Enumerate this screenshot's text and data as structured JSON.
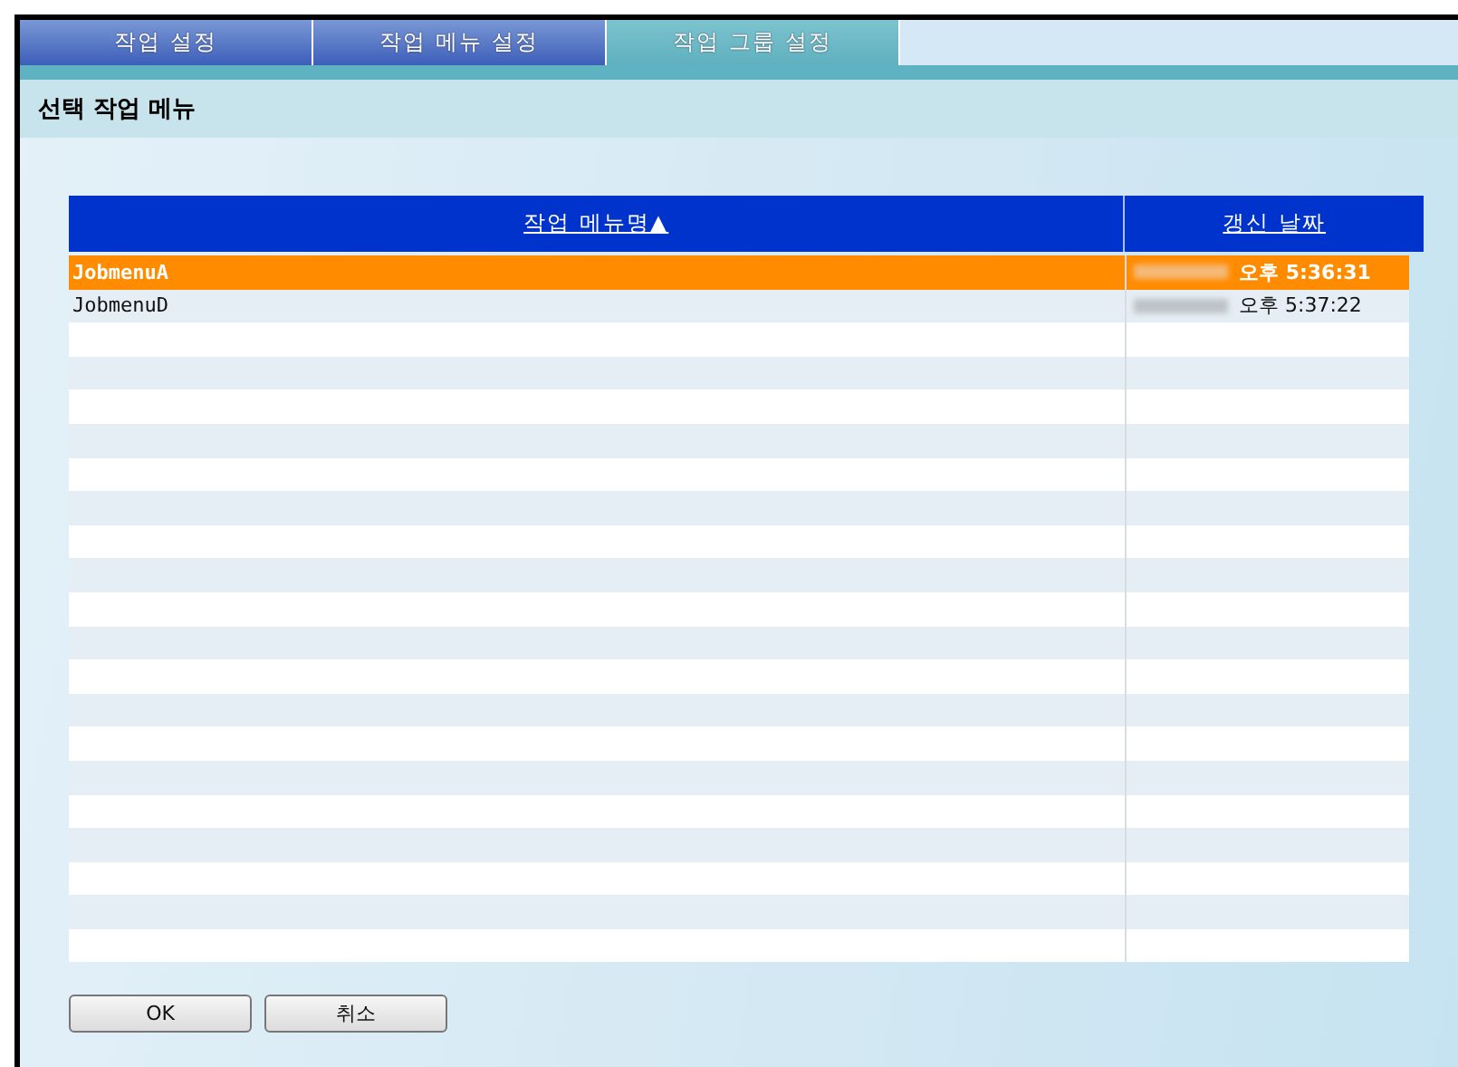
{
  "tabs": [
    {
      "label": "작업 설정",
      "selected": false
    },
    {
      "label": "작업 메뉴 설정",
      "selected": false
    },
    {
      "label": "작업 그룹 설정",
      "selected": true
    }
  ],
  "section_title": "선택 작업 메뉴",
  "table": {
    "columns": [
      "작업 메뉴명▲",
      "갱신 날짜"
    ],
    "rows": [
      {
        "name": "JobmenuA",
        "time": "오후 5:36:31",
        "selected": true
      },
      {
        "name": "JobmenuD",
        "time": "오후 5:37:22",
        "selected": false
      }
    ]
  },
  "buttons": [
    "OK",
    "취소"
  ]
}
